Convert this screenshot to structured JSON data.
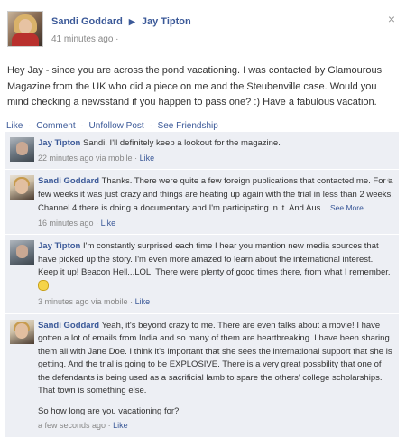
{
  "post": {
    "author": "Sandi Goddard",
    "arrow": "▶",
    "recipient": "Jay Tipton",
    "time": "41 minutes ago",
    "privacy_glyph": "·",
    "close": "×",
    "text": "Hey Jay - since you are across the pond vacationing. I was contacted by Glamourous Magazine from the UK who did a piece on me and the Steubenville case. Would you mind checking a newsstand if you happen to pass one? :) Have a fabulous vacation."
  },
  "actions": {
    "like": "Like",
    "comment": "Comment",
    "unfollow": "Unfollow Post",
    "friendship": "See Friendship",
    "sep": "·"
  },
  "comments": [
    {
      "author": "Jay Tipton",
      "text": "Sandi, I'll definitely keep a lookout for the magazine.",
      "time": "22 minutes ago via mobile",
      "like": "Like",
      "avatar": "jay"
    },
    {
      "author": "Sandi Goddard",
      "text": "Thanks. There were quite a few foreign publications that contacted me. For a few weeks it was just crazy and things are heating up again with the trial in less than 2 weeks. Channel 4 there is doing a documentary and I'm participating in it. And Aus...",
      "see_more": "See More",
      "time": "16 minutes ago",
      "like": "Like",
      "avatar": "sandi"
    },
    {
      "author": "Jay Tipton",
      "text": "I'm constantly surprised each time I hear you mention new media sources that have picked up the story. I'm even more amazed to learn about the international interest. Keep it up! Beacon Hell...LOL. There were plenty of good times there, from what I remember.",
      "time": "3 minutes ago via mobile",
      "like": "Like",
      "avatar": "jay"
    },
    {
      "author": "Sandi Goddard",
      "text": "Yeah, it's beyond crazy to me. There are even talks about a movie! I have gotten a lot of emails from India and so many of them are heartbreaking. I have been sharing them all with Jane Doe. I think it's important that she sees the international support that she is getting. And the trial is going to be EXPLOSIVE. There is a very great possbility that one of the defendants is being used as a sacrificial lamb to spare the others' college scholarships. That town is something else.",
      "text2": "So how long are you vacationing for?",
      "time": "a few seconds ago",
      "like": "Like",
      "avatar": "sandi"
    }
  ]
}
